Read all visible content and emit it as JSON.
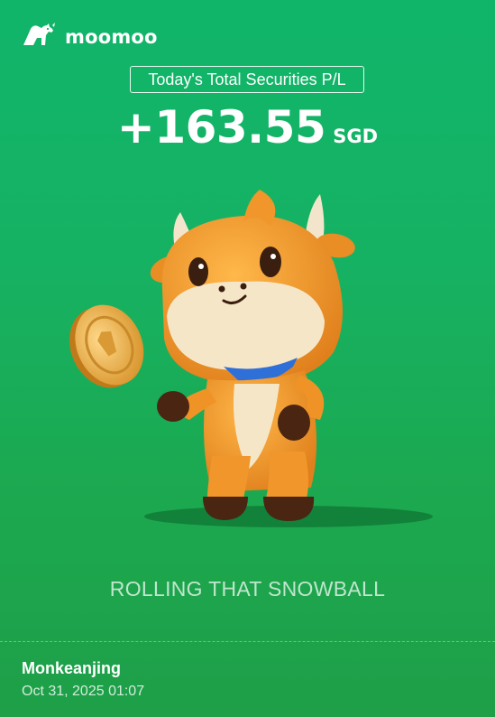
{
  "brand": {
    "name": "moomoo",
    "icon": "bull-logo-icon"
  },
  "pl": {
    "label": "Today's Total Securities P/L",
    "value": "+163.55",
    "currency": "SGD"
  },
  "illustration": {
    "name": "moomoo-bull-mascot",
    "coin_icon": "coin-icon"
  },
  "slogan": "ROLLING THAT SNOWBALL",
  "user": {
    "name": "Monkeanjing",
    "timestamp": "Oct 31, 2025 01:07"
  },
  "colors": {
    "background": "#14b265",
    "mascot": "#f29a2e",
    "scarf": "#2f6fd8",
    "coin": "#e6a93c"
  }
}
